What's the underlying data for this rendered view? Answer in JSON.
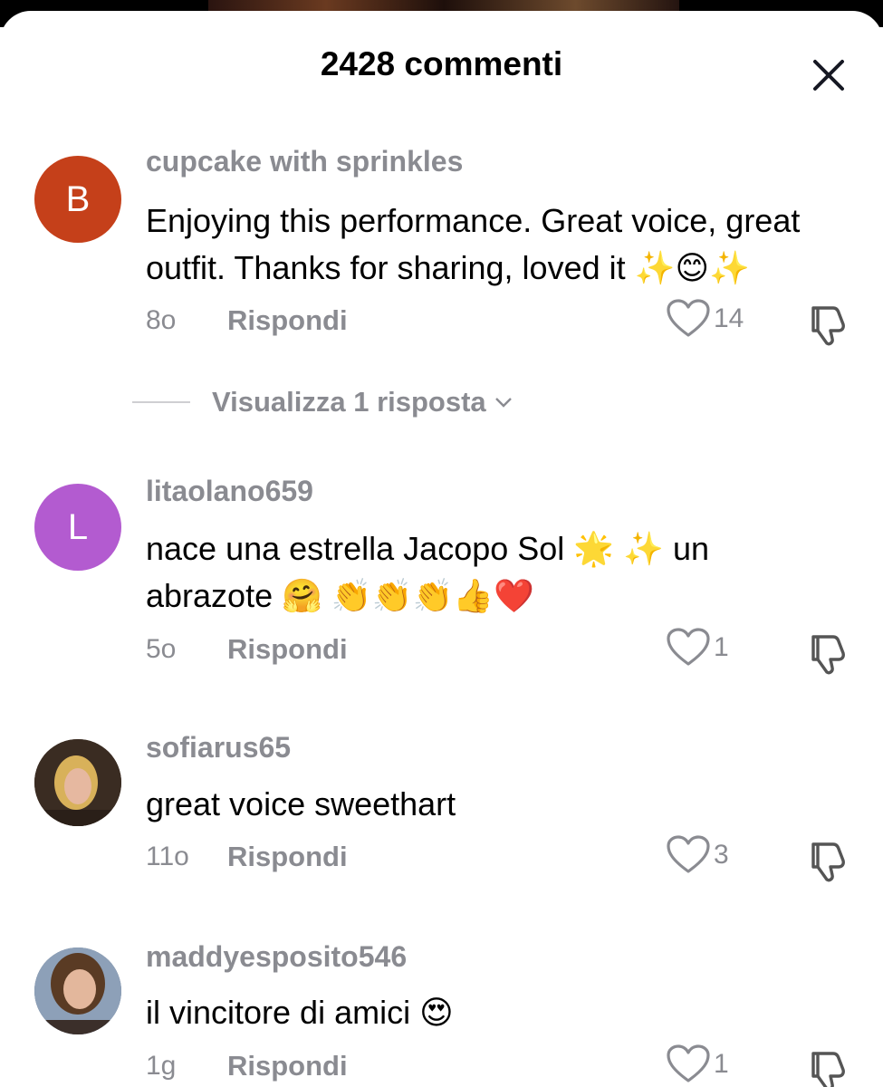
{
  "sheet": {
    "title": "2428 commenti",
    "close_icon": "close-icon"
  },
  "comments": [
    {
      "avatar_letter": "B",
      "avatar_color": "#c5401a",
      "username": "cupcake with sprinkles",
      "text_lines": [
        "Enjoying this performance. Great voice, great",
        "outfit. Thanks for sharing, loved it ✨😊✨"
      ],
      "time": "8o",
      "reply_label": "Rispondi",
      "likes": "14",
      "view_replies": "Visualizza 1 risposta"
    },
    {
      "avatar_letter": "L",
      "avatar_color": "#b35bd0",
      "username": "litaolano659",
      "text_lines": [
        "nace una estrella Jacopo Sol 🌟 ✨ un",
        "abrazote 🤗 👏👏👏👍❤️"
      ],
      "time": "5o",
      "reply_label": "Rispondi",
      "likes": "1"
    },
    {
      "avatar_photo": "profile-photo",
      "username": "sofiarus65",
      "text_lines": [
        "great voice sweethart"
      ],
      "time": "11o",
      "reply_label": "Rispondi",
      "likes": "3"
    },
    {
      "avatar_photo": "profile-photo",
      "username": "maddyesposito546",
      "text_lines": [
        "il vincitore di amici 😍"
      ],
      "time": "1g",
      "reply_label": "Rispondi",
      "likes": "1"
    }
  ],
  "colors": {
    "muted_text": "#8a8b91",
    "primary_text": "#000000",
    "background": "#ffffff"
  }
}
